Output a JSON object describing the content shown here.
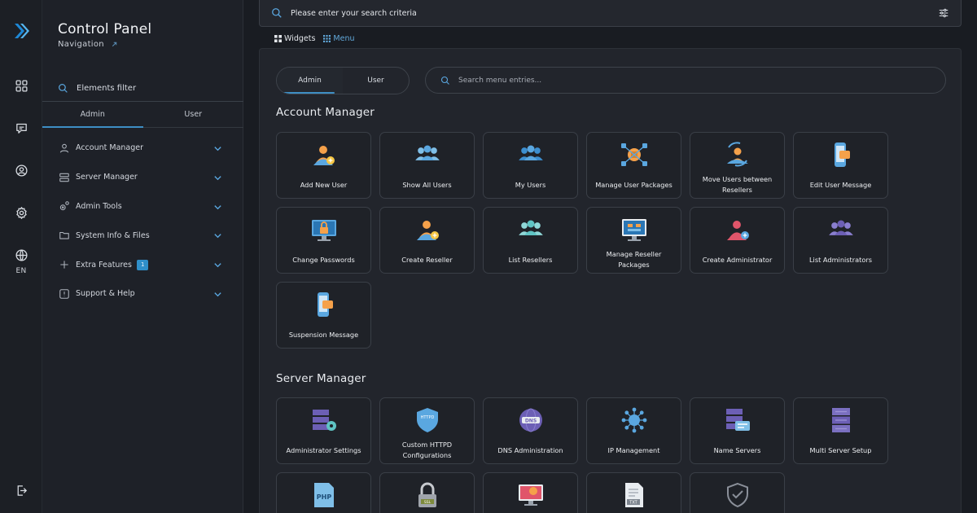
{
  "rail": {
    "language": "EN"
  },
  "nav": {
    "title": "Control Panel",
    "subtitle": "Navigation",
    "filter_label": "Elements filter",
    "tabs": [
      {
        "label": "Admin",
        "active": true
      },
      {
        "label": "User",
        "active": false
      }
    ],
    "items": [
      {
        "label": "Account Manager",
        "icon": "user-icon"
      },
      {
        "label": "Server Manager",
        "icon": "server-icon"
      },
      {
        "label": "Admin Tools",
        "icon": "gears-icon"
      },
      {
        "label": "System Info & Files",
        "icon": "folder-icon"
      },
      {
        "label": "Extra Features",
        "icon": "plus-icon",
        "badge": "1"
      },
      {
        "label": "Support & Help",
        "icon": "alert-icon"
      }
    ]
  },
  "search": {
    "placeholder": "Please enter your search criteria"
  },
  "view_toggle": {
    "widgets_label": "Widgets",
    "menu_label": "Menu",
    "active": "Menu"
  },
  "main": {
    "segment": [
      {
        "label": "Admin",
        "active": true
      },
      {
        "label": "User",
        "active": false
      }
    ],
    "menu_search_placeholder": "Search menu entries...",
    "sections": [
      {
        "title": "Account Manager",
        "tiles": [
          {
            "label": "Add New User",
            "icon": "add-user-icon"
          },
          {
            "label": "Show All Users",
            "icon": "users-group-icon"
          },
          {
            "label": "My Users",
            "icon": "my-users-icon"
          },
          {
            "label": "Manage User Packages",
            "icon": "packages-network-icon"
          },
          {
            "label": "Move Users between Resellers",
            "icon": "move-users-icon"
          },
          {
            "label": "Edit User Message",
            "icon": "phone-message-icon"
          },
          {
            "label": "Change Passwords",
            "icon": "monitor-lock-icon"
          },
          {
            "label": "Create Reseller",
            "icon": "create-reseller-icon"
          },
          {
            "label": "List Resellers",
            "icon": "list-resellers-icon"
          },
          {
            "label": "Manage Reseller Packages",
            "icon": "monitor-packages-icon"
          },
          {
            "label": "Create Administrator",
            "icon": "create-admin-icon"
          },
          {
            "label": "List Administrators",
            "icon": "list-admins-icon"
          },
          {
            "label": "Suspension Message",
            "icon": "phone-message-icon"
          }
        ]
      },
      {
        "title": "Server Manager",
        "tiles": [
          {
            "label": "Administrator Settings",
            "icon": "admin-settings-icon"
          },
          {
            "label": "Custom HTTPD Configurations",
            "icon": "httpd-shield-icon"
          },
          {
            "label": "DNS Administration",
            "icon": "dns-globe-icon"
          },
          {
            "label": "IP Management",
            "icon": "ip-network-icon"
          },
          {
            "label": "Name Servers",
            "icon": "name-servers-icon"
          },
          {
            "label": "Multi Server Setup",
            "icon": "server-stack-icon"
          },
          {
            "label": "",
            "icon": "php-file-icon"
          },
          {
            "label": "",
            "icon": "ssl-lock-icon"
          },
          {
            "label": "",
            "icon": "monitor-alert-icon"
          },
          {
            "label": "",
            "icon": "txt-file-icon"
          },
          {
            "label": "",
            "icon": "shield-check-icon"
          }
        ]
      }
    ]
  },
  "colors": {
    "accent": "#3e8ec4",
    "background": "#191c22",
    "panel": "#22252c",
    "tile": "#1f2228",
    "orange": "#f5a14a",
    "blue_icon": "#5aa7e0",
    "red_icon": "#e0556a",
    "purple_icon": "#6c5fb5"
  }
}
